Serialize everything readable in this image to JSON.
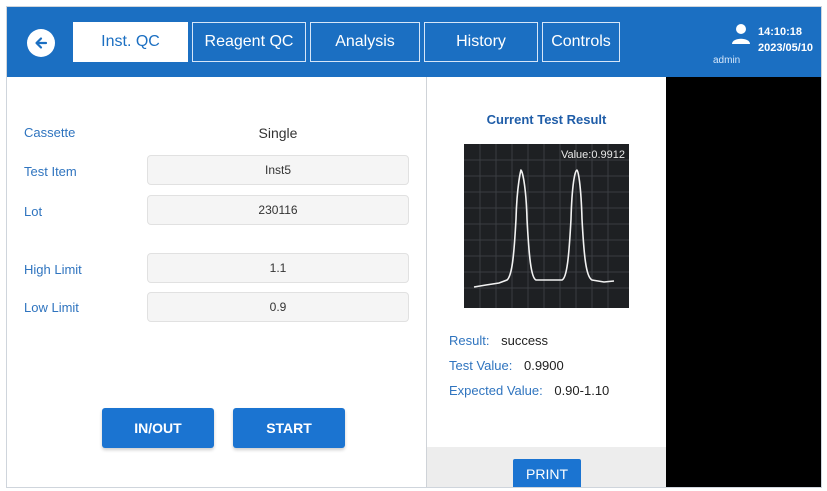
{
  "header": {
    "tabs": [
      {
        "label": "Inst. QC",
        "active": true
      },
      {
        "label": "Reagent QC",
        "active": false
      },
      {
        "label": "Analysis",
        "active": false
      },
      {
        "label": "History",
        "active": false
      },
      {
        "label": "Controls",
        "active": false
      }
    ],
    "user": "admin",
    "time": "14:10:18",
    "date": "2023/05/10"
  },
  "form": {
    "cassette_label": "Cassette",
    "cassette_value": "Single",
    "test_item_label": "Test Item",
    "test_item_value": "Inst5",
    "lot_label": "Lot",
    "lot_value": "230116",
    "high_limit_label": "High Limit",
    "high_limit_value": "1.1",
    "low_limit_label": "Low Limit",
    "low_limit_value": "0.9"
  },
  "buttons": {
    "inout": "IN/OUT",
    "start": "START",
    "print": "PRINT"
  },
  "result": {
    "title": "Current Test Result",
    "chart_value": "Value:0.9912",
    "result_label": "Result:",
    "result_value": "success",
    "test_value_label": "Test Value:",
    "test_value": "0.9900",
    "expected_label": "Expected Value:",
    "expected_value": "0.90-1.10"
  },
  "colors": {
    "accent": "#1b6fc2",
    "button": "#1b74d1",
    "label": "#2f74bf"
  },
  "icons": {
    "back": "back-arrow-icon",
    "user": "user-icon"
  }
}
